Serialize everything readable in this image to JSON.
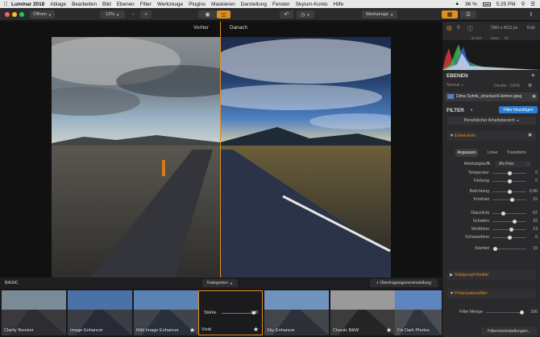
{
  "menubar": {
    "app": "Luminar 2018",
    "items": [
      "Ablage",
      "Bearbeiten",
      "Bild",
      "Ebenen",
      "Filter",
      "Werkzeuge",
      "Plugins",
      "Maskieren",
      "Darstellung",
      "Fenster",
      "Skylum-Konto",
      "Hilfe"
    ],
    "battery": "96 %",
    "time": "5:25 PM"
  },
  "toolbar": {
    "open_label": "Öffnen",
    "zoom": "12%",
    "zoom_minus": "–",
    "zoom_plus": "+",
    "tools_label": "Werkzeuge"
  },
  "canvas": {
    "before_label": "Vorher",
    "after_label": "Danach"
  },
  "filmbar": {
    "section": "BASIC",
    "categories": "Kategorien",
    "transfer": "+ Übertragungsvoreinstellung"
  },
  "presets": [
    {
      "name": "Clarity Booster",
      "star": false
    },
    {
      "name": "Image Enhancer",
      "star": false
    },
    {
      "name": "Mild Image Enhancer",
      "star": true
    },
    {
      "name": "Vivid",
      "star": true,
      "selected": true,
      "slider_label": "Stärke",
      "slider_value": "100",
      "slider_level": 1.0
    },
    {
      "name": "Sky Enhancer",
      "star": false
    },
    {
      "name": "Classic B&W",
      "star": true
    },
    {
      "name": "Fix Dark Photos",
      "star": false
    }
  ],
  "image_info": {
    "dimensions": "7360 x 4912 px",
    "bitdepth": "8-bit",
    "exif": [
      "60:400",
      "16mm",
      "f/3"
    ]
  },
  "layers": {
    "title": "EBENEN",
    "blend_mode": "Normal",
    "opacity_label": "Deckkr.: 100%",
    "file": "Dima Sytnik_structure5-before.jpeg"
  },
  "filter": {
    "title": "FILTER",
    "add_button": "Filter hinzufügen",
    "workspace": "Persönlicher Arbeitsbereich",
    "develop": "Entwickeln",
    "tabs": [
      "Anpassen",
      "Linse",
      "Transform."
    ],
    "wb_label": "Weißabgleich",
    "wb_value": "Als Foto",
    "sliders": [
      {
        "label": "Temperatur",
        "value": "0",
        "level": 0.5
      },
      {
        "label": "Färbung",
        "value": "0",
        "level": 0.5
      },
      {
        "label": "Belichtung",
        "value": "0,00",
        "level": 0.5
      },
      {
        "label": "Kontrast",
        "value": "15",
        "level": 0.58
      },
      {
        "label": "Glanzlicht",
        "value": "-37",
        "level": 0.32
      },
      {
        "label": "Schatten",
        "value": "32",
        "level": 0.66
      },
      {
        "label": "Weißtöne",
        "value": "13",
        "level": 0.57
      },
      {
        "label": "Schwarztöne",
        "value": "0",
        "level": 0.5
      },
      {
        "label": "Klarheit",
        "value": "15",
        "level": 0.08
      }
    ],
    "sections": [
      "Sättigung/Vitalität",
      "Polarisationsfilter"
    ],
    "filter_amount_label": "Filter Menge",
    "filter_amount_value": "100",
    "filter_amount_level": 1.0,
    "presets_link": "Filtervoreinstellungen..."
  }
}
